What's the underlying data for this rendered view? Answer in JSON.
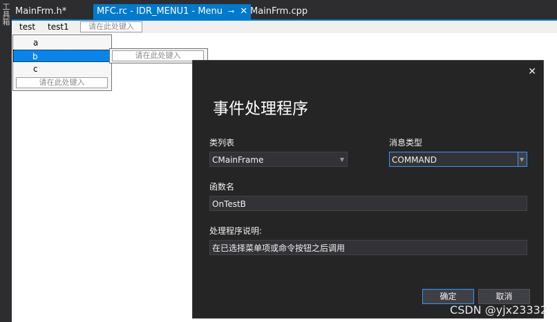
{
  "side": {
    "label": "工具箱"
  },
  "tabs": [
    {
      "label": "MainFrm.h*"
    },
    {
      "label": "MFC.rc - IDR_MENU1 - Menu",
      "pin": "⊸",
      "close": "✕"
    },
    {
      "label": "MainFrm.cpp"
    }
  ],
  "menubar": {
    "items": [
      "test",
      "test1"
    ],
    "type_here": "请在此处键入"
  },
  "dropdown": {
    "items": [
      "a",
      "b",
      "c"
    ],
    "selected": "b",
    "type_here": "请在此处键入",
    "submenu_type_here": "请在此处键入"
  },
  "dialog": {
    "title": "事件处理程序",
    "close": "✕",
    "class_list_label": "类列表",
    "class_list_value": "CMainFrame",
    "message_type_label": "消息类型",
    "message_type_value": "COMMAND",
    "function_name_label": "函数名",
    "function_name_value": "OnTestB",
    "handler_desc_label": "处理程序说明:",
    "handler_desc_value": "在已选择菜单项或命令按钮之后调用",
    "ok_label": "确定",
    "cancel_label": "取消"
  },
  "watermark": "CSDN @yjx23332",
  "colors": {
    "accent": "#007acc",
    "dialog_bg": "#252526",
    "selection": "#0b84ea"
  }
}
